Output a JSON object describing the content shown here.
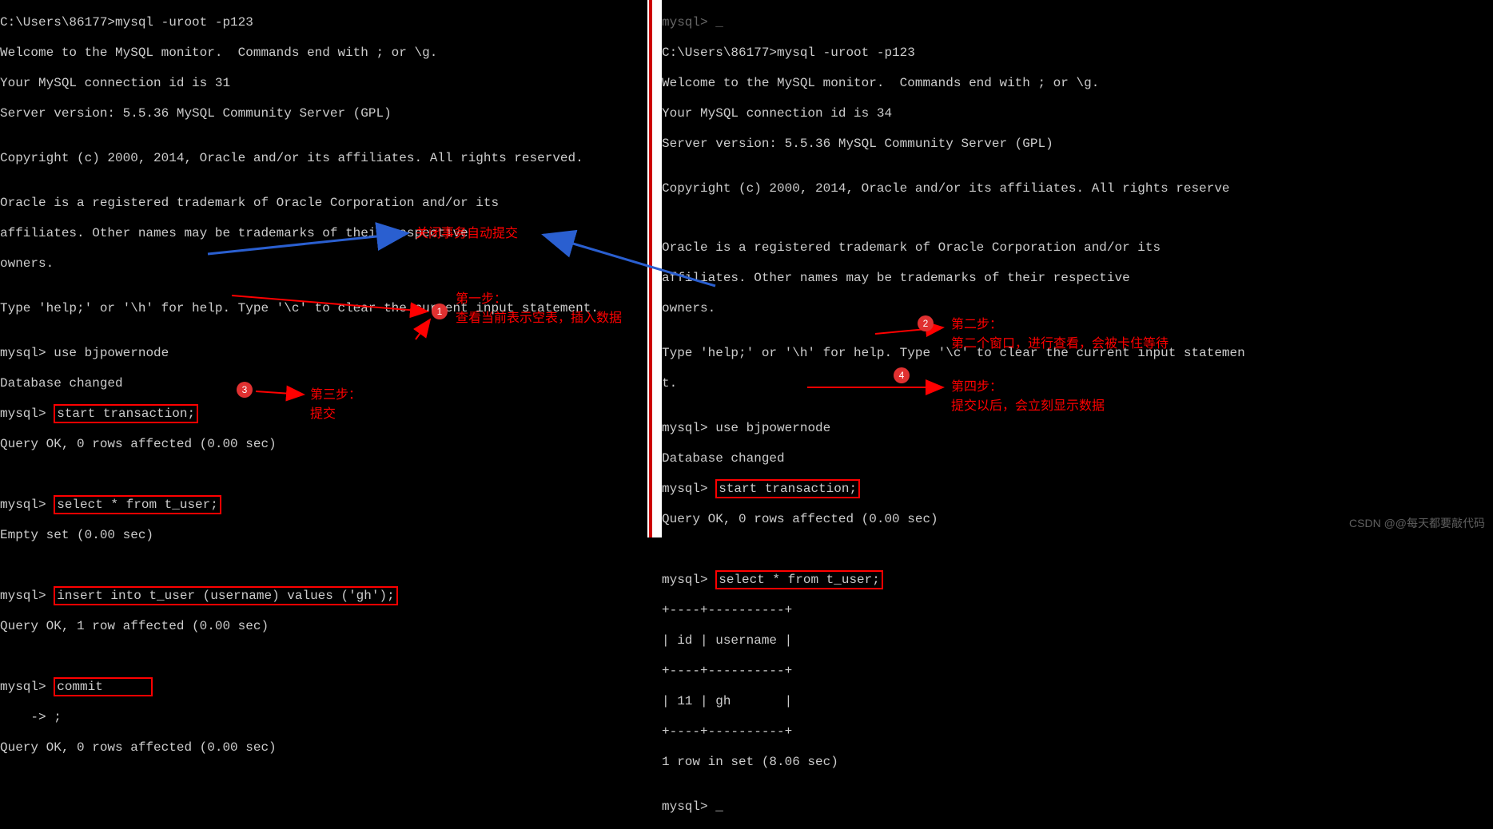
{
  "left": {
    "l1": "C:\\Users\\86177>mysql -uroot -p123",
    "l2": "Welcome to the MySQL monitor.  Commands end with ; or \\g.",
    "l3": "Your MySQL connection id is 31",
    "l4": "Server version: 5.5.36 MySQL Community Server (GPL)",
    "l5": "",
    "l6": "Copyright (c) 2000, 2014, Oracle and/or its affiliates. All rights reserved.",
    "l7": "",
    "l8": "Oracle is a registered trademark of Oracle Corporation and/or its",
    "l9": "affiliates. Other names may be trademarks of their respective",
    "l10": "owners.",
    "l11": "",
    "l12": "Type 'help;' or '\\h' for help. Type '\\c' to clear the current input statement.",
    "l13": "",
    "prompt_use": "mysql> ",
    "use_cmd": "use bjpowernode",
    "db_changed": "Database changed",
    "start_tx": "start transaction;",
    "qok": "Query OK, 0 rows affected (0.00 sec)",
    "select": "select * from t_user;",
    "empty": "Empty set (0.00 sec)",
    "insert": "insert into t_user (username) values ('gh');",
    "qok_1row": "Query OK, 1 row affected (0.00 sec)",
    "commit": "commit",
    "cont": "    -> ;",
    "qok2": "Query OK, 0 rows affected (0.00 sec)"
  },
  "right": {
    "top": "mysql> _",
    "l1": "C:\\Users\\86177>mysql -uroot -p123",
    "l2": "Welcome to the MySQL monitor.  Commands end with ; or \\g.",
    "l3": "Your MySQL connection id is 34",
    "l4": "Server version: 5.5.36 MySQL Community Server (GPL)",
    "l5": "",
    "l6": "Copyright (c) 2000, 2014, Oracle and/or its affiliates. All rights reserve",
    "l7": "",
    "l8": "",
    "l9": "Oracle is a registered trademark of Oracle Corporation and/or its",
    "l10": "affiliates. Other names may be trademarks of their respective",
    "l11": "owners.",
    "l12": "",
    "l13": "Type 'help;' or '\\h' for help. Type '\\c' to clear the current input statemen",
    "l13b": "t.",
    "l14": "",
    "use_cmd": "use bjpowernode",
    "db_changed": "Database changed",
    "start_tx": "start transaction;",
    "qok": "Query OK, 0 rows affected (0.00 sec)",
    "select": "select * from t_user;",
    "tbl_border": "+----+----------+",
    "tbl_header": "| id | username |",
    "tbl_row": "| 11 | gh       |",
    "rowinset": "1 row in set (8.06 sec)",
    "blank": "",
    "lastprompt": "mysql> _"
  },
  "annotations": {
    "close_tx": "关闭事务自动提交",
    "step1_title": "第一步：",
    "step1_body": "查看当前表示空表，插入数据",
    "step2_title": "第二步：",
    "step2_body": "第二个窗口，进行查看，会被卡住等待",
    "step3_title": "第三步：",
    "step3_body": "提交",
    "step4_title": "第四步：",
    "step4_body": "提交以后，会立刻显示数据",
    "badge1": "1",
    "badge2": "2",
    "badge3": "3",
    "badge4": "4"
  },
  "watermark": "CSDN @@每天都要敲代码"
}
